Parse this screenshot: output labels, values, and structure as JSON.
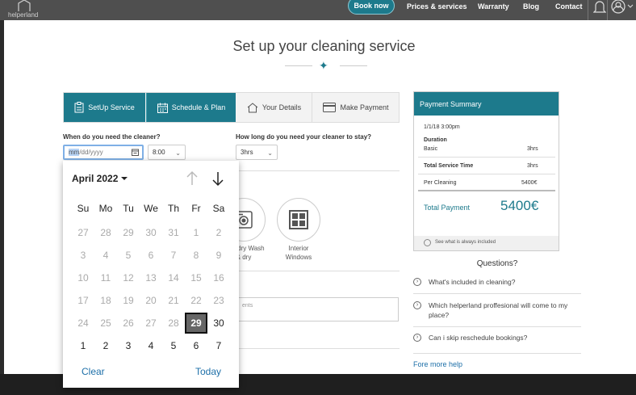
{
  "nav": {
    "logo_text": "helperland",
    "book_now": "Book now",
    "links": [
      "Prices & services",
      "Warranty",
      "Blog",
      "Contact"
    ]
  },
  "page": {
    "title": "Set up your cleaning service"
  },
  "tabs": [
    {
      "label": "SetUp Service",
      "icon": "clipboard-icon",
      "active": true
    },
    {
      "label": "Schedule & Plan",
      "icon": "calendar-icon",
      "active": true
    },
    {
      "label": "Your Details",
      "icon": "house-icon",
      "active": false
    },
    {
      "label": "Make Payment",
      "icon": "card-icon",
      "active": false
    }
  ],
  "form": {
    "when_label": "When do you need the cleaner?",
    "date_selected_part": "mm",
    "date_rest": "/dd/yyyy",
    "time_value": "8:00",
    "duration_label": "How long do you need your cleaner to stay?",
    "duration_value": "3hrs",
    "extras": [
      {
        "label_line1": "Laundry Wash",
        "label_line2": "& dry",
        "icon": "washing-machine-icon"
      },
      {
        "label_line1": "Interior",
        "label_line2": "Windows",
        "icon": "window-icon"
      }
    ],
    "comments_text": "ents"
  },
  "payment": {
    "title": "Payment Summary",
    "datetime": "1/1/18  3:00pm",
    "duration_label": "Duration",
    "basic_label": "Basic",
    "basic_value": "3hrs",
    "total_time_label": "Total Service Time",
    "total_time_value": "3hrs",
    "per_cleaning_label": "Per Cleaning",
    "per_cleaning_value": "5400€",
    "total_label": "Total Payment",
    "total_value": "5400€",
    "footer": "See what is always included"
  },
  "faq": {
    "title": "Questions?",
    "items": [
      "What's included in cleaning?",
      "Which helperland proffesional will come to my place?",
      "Can i skip reschedule bookings?"
    ],
    "more": "Fore more help"
  },
  "picker": {
    "month": "April 2022",
    "weekdays": [
      "Su",
      "Mo",
      "Tu",
      "We",
      "Th",
      "Fr",
      "Sa"
    ],
    "weeks": [
      [
        "27",
        "28",
        "29",
        "30",
        "31",
        "1",
        "2"
      ],
      [
        "3",
        "4",
        "5",
        "6",
        "7",
        "8",
        "9"
      ],
      [
        "10",
        "11",
        "12",
        "13",
        "14",
        "15",
        "16"
      ],
      [
        "17",
        "18",
        "19",
        "20",
        "21",
        "22",
        "23"
      ],
      [
        "24",
        "25",
        "26",
        "27",
        "28",
        "29",
        "30"
      ],
      [
        "1",
        "2",
        "3",
        "4",
        "5",
        "6",
        "7"
      ]
    ],
    "selected": {
      "week": 4,
      "day": 5
    },
    "enabled_from": {
      "week": 4,
      "day": 5
    },
    "clear": "Clear",
    "today": "Today"
  },
  "colors": {
    "accent": "#1d7a8c",
    "link": "#1d6fa8"
  }
}
